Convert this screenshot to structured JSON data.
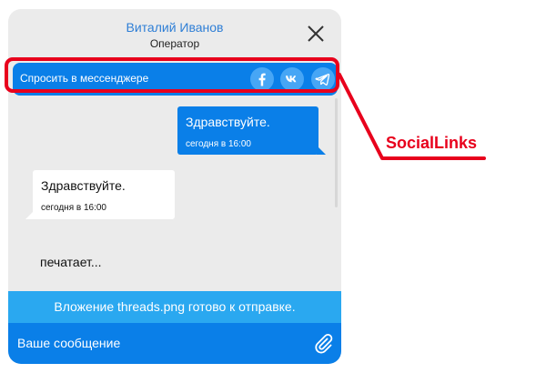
{
  "header": {
    "operator_name": "Виталий Иванов",
    "operator_role": "Оператор",
    "close_icon": "close-icon"
  },
  "social_bar": {
    "label": "Спросить в мессенджере",
    "links": [
      {
        "name": "Facebook",
        "icon": "facebook-icon"
      },
      {
        "name": "VK",
        "icon": "vk-icon"
      },
      {
        "name": "Telegram",
        "icon": "telegram-icon"
      }
    ]
  },
  "messages": [
    {
      "direction": "out",
      "text": "Здравствуйте.",
      "time": "сегодня в 16:00"
    },
    {
      "direction": "in",
      "text": "Здравствуйте.",
      "time": "сегодня в 16:00"
    }
  ],
  "typing_indicator": "печатает...",
  "attachment_notice": "Вложение threads.png готово к отправке.",
  "composer": {
    "value": "",
    "placeholder": "Ваше сообщение",
    "attach_icon": "paperclip-icon"
  },
  "annotation": {
    "label": "SocialLinks"
  },
  "colors": {
    "widget_bg": "#ebebeb",
    "accent_blue": "#0a7fe8",
    "attachment_blue": "#2aa8f0",
    "operator_name": "#2f7fd6",
    "annotation_red": "#e8001c"
  }
}
